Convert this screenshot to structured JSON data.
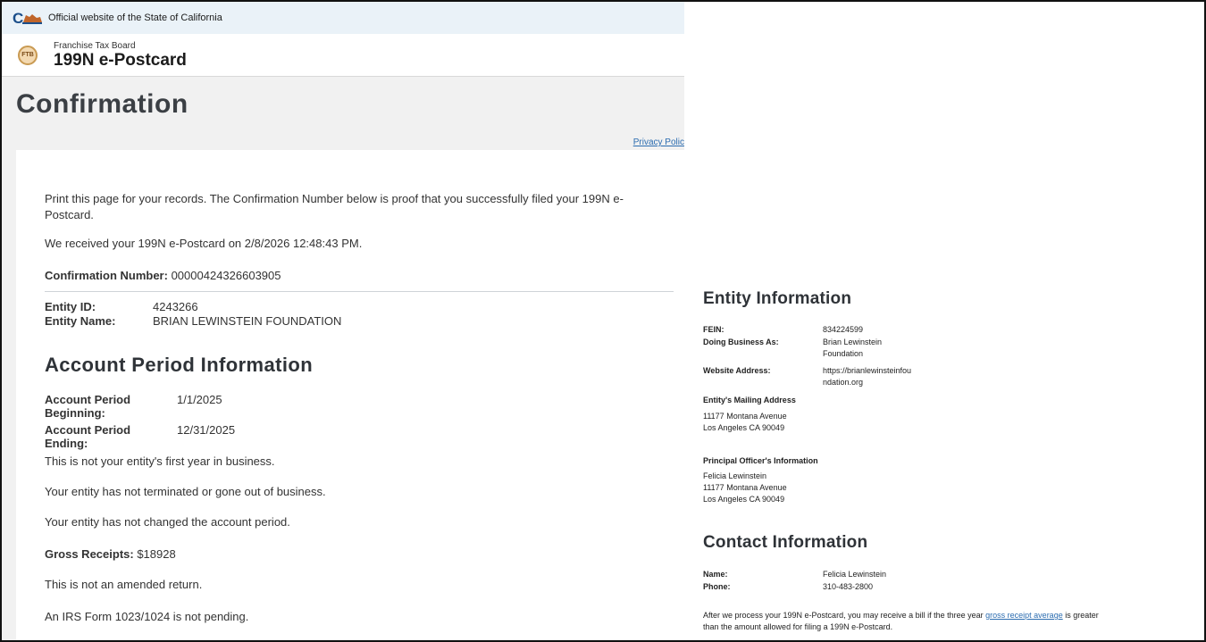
{
  "gov_bar": {
    "text": "Official website of the State of California",
    "logo_text": "CA"
  },
  "brand": {
    "agency": "Franchise Tax Board",
    "app": "199N e-Postcard",
    "seal": "FTB"
  },
  "page": {
    "title": "Confirmation",
    "privacy_link": "Privacy Polic"
  },
  "intro": {
    "line1": "Print this page for your records. The Confirmation Number below is proof that you successfully filed your 199N e-",
    "line2": "Postcard.",
    "received": "We received your 199N e-Postcard on 2/8/2026 12:48:43 PM.",
    "confirmation_label": "Confirmation Number:",
    "confirmation_value": "00000424326603905"
  },
  "entity": {
    "id_label": "Entity ID:",
    "id_value": "4243266",
    "name_label": "Entity Name:",
    "name_value": "BRIAN LEWINSTEIN FOUNDATION"
  },
  "account_period": {
    "heading": "Account Period Information",
    "begin_label_1": "Account Period",
    "begin_label_2": "Beginning:",
    "begin_value": "1/1/2025",
    "end_label": "Account Period Ending:",
    "end_value": "12/31/2025",
    "first_year": "This is not your entity's first year in business.",
    "terminated": "Your entity has not terminated or gone out of business.",
    "changed": "Your entity has not changed the account period.",
    "gross_label": "Gross Receipts:",
    "gross_value": "$18928",
    "amended": "This is not an amended return.",
    "irs_form": "An IRS Form 1023/1024 is not pending."
  },
  "entity_info": {
    "heading": "Entity Information",
    "fein_label": "FEIN:",
    "fein_value": "834224599",
    "dba_label": "Doing Business As:",
    "dba_value_1": "Brian Lewinstein",
    "dba_value_2": "Foundation",
    "web_label": "Website Address:",
    "web_value_1": "https://brianlewinsteinfou",
    "web_value_2": "ndation.org",
    "mailing_heading": "Entity's Mailing Address",
    "mailing_line1": "11177 Montana Avenue",
    "mailing_line2": "Los Angeles CA 90049",
    "officer_heading": "Principal Officer's Information",
    "officer_name": "Felicia Lewinstein",
    "officer_line1": "11177 Montana Avenue",
    "officer_line2": "Los Angeles CA 90049"
  },
  "contact_info": {
    "heading": "Contact Information",
    "name_label": "Name:",
    "name_value": "Felicia Lewinstein",
    "phone_label": "Phone:",
    "phone_value": "310-483-2800",
    "note_pre": "After we process your 199N e-Postcard, you may receive a bill if the three year ",
    "note_link": "gross receipt average",
    "note_post": " is greater",
    "note_line2": "than the amount allowed for filing a 199N e-Postcard."
  },
  "colors": {
    "link": "#2b6cb0",
    "band": "#f1f1f1",
    "gov_bar": "#eaf2f8"
  }
}
